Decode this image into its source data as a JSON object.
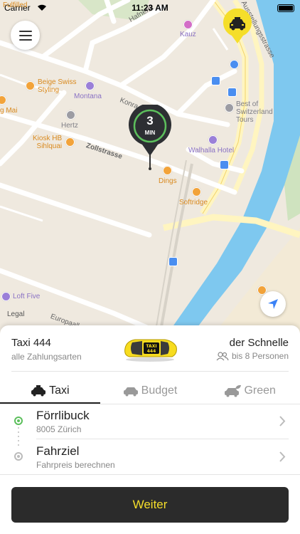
{
  "status_bar": {
    "carrier": "Carrier",
    "time": "11:23 AM"
  },
  "map": {
    "pois": {
      "kauz": "Kauz",
      "beige": "Beige Swiss\nStyling",
      "montana": "Montana",
      "gmai": "g Mai",
      "hertz": "Hertz",
      "kiosk": "Kiosk HB\nSihlquai",
      "walhalla": "Walhalla Hotel",
      "best": "Best of\nSwitzerland\nTours",
      "dings": "Dings",
      "softridge": "Softridge",
      "loft": "Loft Five",
      "fulfilled": "Fulfilled"
    },
    "streets": {
      "zollstrasse": "Zollstrasse",
      "ausstellung": "Ausstellungsstrasse",
      "hafner": "Hafnerst",
      "konrad": "Konra",
      "europa": "Europaall",
      "v": "V"
    },
    "eta": {
      "value": "3",
      "unit": "MIN"
    },
    "legal": "Legal",
    "icons": {
      "menu": "hamburger-menu-icon",
      "locate": "location-arrow-icon",
      "taxi_pin": "taxi-pin-icon"
    }
  },
  "service": {
    "name": "Taxi 444",
    "payment": "alle Zahlungsarten",
    "speed": "der Schnelle",
    "persons": "bis 8 Personen"
  },
  "tabs": [
    {
      "label": "Taxi",
      "active": true,
      "icon": "taxi-icon"
    },
    {
      "label": "Budget",
      "active": false,
      "icon": "car-icon"
    },
    {
      "label": "Green",
      "active": false,
      "icon": "eco-car-icon"
    }
  ],
  "route": {
    "pickup": {
      "title": "Förrlibuck",
      "subtitle": "8005 Zürich"
    },
    "destination": {
      "title": "Fahrziel",
      "subtitle": "Fahrpreis berechnen"
    }
  },
  "continue_label": "Weiter",
  "colors": {
    "accent_yellow": "#f5de2a",
    "button_dark": "#2b2b2b",
    "eta_ring_green": "#5cbf5c",
    "water": "#7ec8ef"
  }
}
